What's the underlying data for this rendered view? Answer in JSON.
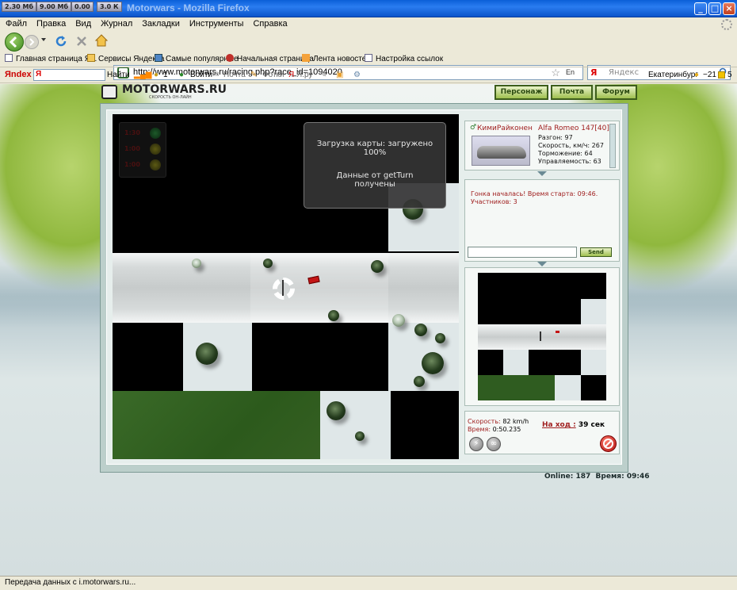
{
  "browser": {
    "title": "Motorwars - Mozilla Firefox",
    "memory_chips": [
      "2.30 Мб",
      "9.00 Мб",
      "0.00",
      "3.0 К"
    ],
    "menu": [
      "Файл",
      "Правка",
      "Вид",
      "Журнал",
      "Закладки",
      "Инструменты",
      "Справка"
    ],
    "url": "http://www.motorwars.ru/racing.php?race_id=1094020",
    "search_placeholder": "Яндекс",
    "search_engine": "Я",
    "bookmarks": [
      "Главная страница Я...",
      "Сервисы Яндекса",
      "Самые популярные",
      "Начальная страница",
      "Лента новостей",
      "Настройка ссылок"
    ],
    "yandex_bar": {
      "logo": "Яndex",
      "search_btn": "Найти",
      "mail_count": "1",
      "login": "Войти",
      "mail": "Почта",
      "photos": "Фотки",
      "yaru": "Я.ру",
      "city": "Екатеринбург",
      "temp": "−21",
      "traffic": "5"
    },
    "status": "Передача данных с i.motorwars.ru..."
  },
  "site": {
    "logo": "MOTORWARS.RU",
    "logo_sub": "СКОРОСТЬ ОН-ЛАЙН",
    "nav": [
      "Персонаж",
      "Почта",
      "Форум"
    ],
    "loading": {
      "line1": "Загрузка карты: загружено",
      "line2": "100%",
      "line3": "Данные от getTurn",
      "line4": "получены"
    },
    "lights": [
      "1:30",
      "1:00",
      "1:00"
    ],
    "player": {
      "name": "КимиРайконен",
      "car": "Alfa Romeo 147[40]",
      "stats": [
        "Разгон: 97",
        "Скорость, км/ч: 267",
        "Торможение: 64",
        "Управляемость: 63"
      ]
    },
    "chat": {
      "line1": "Гонка началась! Время старта: 09:46.",
      "line2": "Участников: 3",
      "send": "Send"
    },
    "hud": {
      "speed_label": "Скорость:",
      "speed": "82 km/h",
      "time_label": "Время:",
      "time": "0:50.235",
      "turn_label": "На ход :",
      "turn": "39 сек"
    },
    "footer": {
      "online": "Online: 187",
      "time": "Время: 09:46"
    }
  },
  "colors": {
    "title_blue": "#0a5fd8",
    "accent_green": "#3d5d1b",
    "red_text": "#a02020",
    "send_btn": "#9fc04f"
  }
}
